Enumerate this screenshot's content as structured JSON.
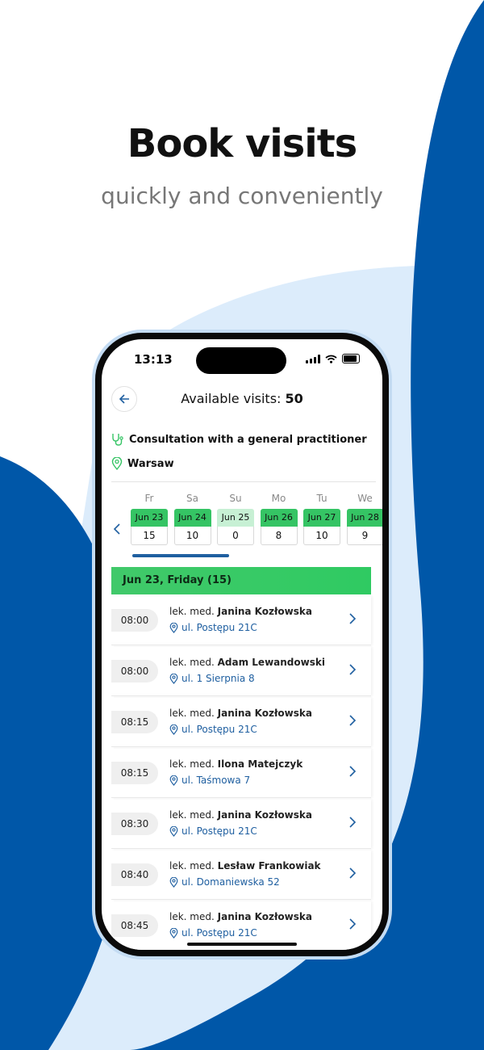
{
  "marketing": {
    "headline": "Book visits",
    "subheadline": "quickly and conveniently"
  },
  "colors": {
    "brand_blue": "#0057a8",
    "light_blue": "#dcecfb",
    "accent_green": "#35c464",
    "link_blue": "#1f5fa0"
  },
  "status_bar": {
    "time": "13:13"
  },
  "header": {
    "title_prefix": "Available visits: ",
    "count": "50",
    "back_icon": "back-arrow-icon"
  },
  "filters": {
    "service": "Consultation with a general practitioner",
    "service_icon": "stethoscope-icon",
    "location": "Warsaw",
    "location_icon": "map-pin-icon"
  },
  "days": [
    {
      "name": "Fr",
      "date": "Jun 23",
      "count": "15",
      "state": "on"
    },
    {
      "name": "Sa",
      "date": "Jun 24",
      "count": "10",
      "state": "on"
    },
    {
      "name": "Su",
      "date": "Jun 25",
      "count": "0",
      "state": "empty"
    },
    {
      "name": "Mo",
      "date": "Jun 26",
      "count": "8",
      "state": "on"
    },
    {
      "name": "Tu",
      "date": "Jun 27",
      "count": "10",
      "state": "on"
    },
    {
      "name": "We",
      "date": "Jun 28",
      "count": "9",
      "state": "on"
    }
  ],
  "selected_day_header": "Jun 23, Friday (15)",
  "slots": [
    {
      "time": "08:00",
      "title": "lek. med. ",
      "name": "Janina Kozłowska",
      "address": "ul. Postępu 21C"
    },
    {
      "time": "08:00",
      "title": "lek. med. ",
      "name": "Adam Lewandowski",
      "address": "ul. 1 Sierpnia 8"
    },
    {
      "time": "08:15",
      "title": "lek. med. ",
      "name": "Janina Kozłowska",
      "address": "ul. Postępu 21C"
    },
    {
      "time": "08:15",
      "title": "lek. med. ",
      "name": "Ilona Matejczyk",
      "address": "ul. Taśmowa 7"
    },
    {
      "time": "08:30",
      "title": "lek. med. ",
      "name": "Janina Kozłowska",
      "address": "ul. Postępu 21C"
    },
    {
      "time": "08:40",
      "title": "lek. med. ",
      "name": "Lesław Frankowiak",
      "address": "ul. Domaniewska 52"
    },
    {
      "time": "08:45",
      "title": "lek. med. ",
      "name": "Janina Kozłowska",
      "address": "ul. Postępu 21C"
    }
  ]
}
